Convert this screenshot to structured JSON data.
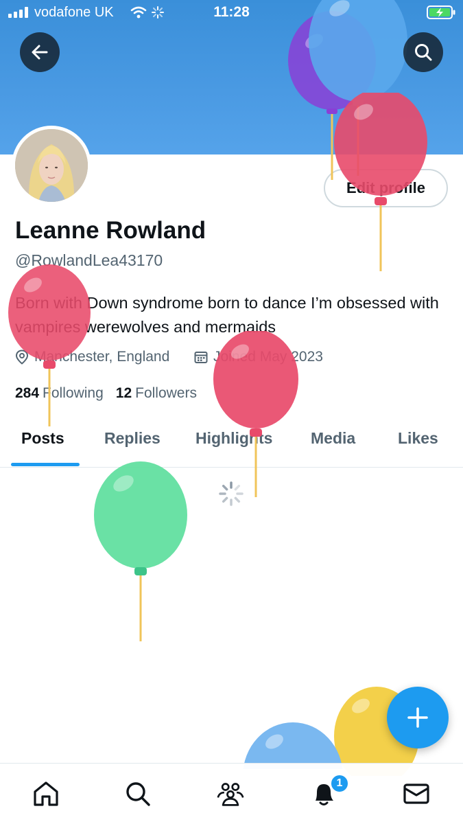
{
  "status_bar": {
    "carrier": "vodafone UK",
    "time": "11:28"
  },
  "profile": {
    "name": "Leanne Rowland",
    "handle": "@RowlandLea43170",
    "bio": "Born with Down syndrome born to dance I’m obsessed with vampires werewolves and mermaids",
    "location": "Manchester, England",
    "joined": "Joined May 2023",
    "following_count": "284",
    "following_label": "Following",
    "followers_count": "12",
    "followers_label": "Followers",
    "edit_label": "Edit profile"
  },
  "tabs": [
    {
      "label": "Posts",
      "active": true
    },
    {
      "label": "Replies",
      "active": false
    },
    {
      "label": "Highlights",
      "active": false
    },
    {
      "label": "Media",
      "active": false
    },
    {
      "label": "Likes",
      "active": false
    }
  ],
  "notifications_badge": "1",
  "icons": {
    "back": "back-arrow-icon",
    "search": "search-icon",
    "location": "location-pin-icon",
    "calendar": "calendar-icon",
    "compose": "plus-icon",
    "home": "home-icon",
    "communities": "communities-icon",
    "notifications": "bell-icon",
    "messages": "envelope-icon"
  },
  "colors": {
    "accent": "#1d9bf0",
    "banner": "#4a9ae3",
    "balloon_red": "#e84a6a",
    "balloon_purple": "#8a3fd6",
    "balloon_blue": "#5aa8ec",
    "balloon_green": "#62dfa0",
    "balloon_yellow": "#f3d04a"
  }
}
